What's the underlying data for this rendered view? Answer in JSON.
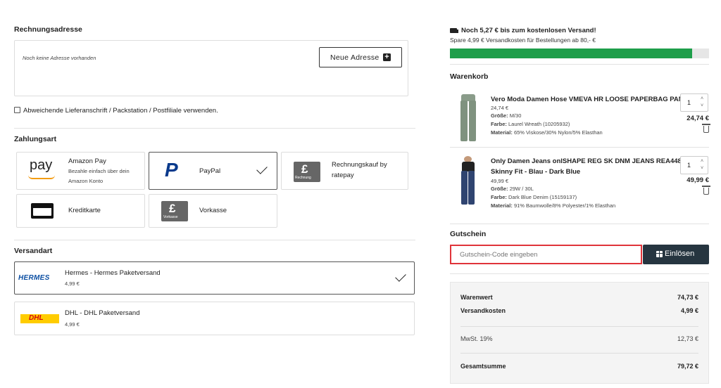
{
  "billing": {
    "title": "Rechnungsadresse",
    "empty_text": "Noch keine Adresse vorhanden",
    "new_address_label": "Neue Adresse",
    "alt_shipping_label": "Abweichende Lieferanschrift / Packstation / Postfiliale verwenden."
  },
  "payment": {
    "title": "Zahlungsart",
    "amazon": {
      "logo": "pay",
      "name": "Amazon Pay",
      "desc_1": "Bezahle einfach über dein",
      "desc_2": "Amazon Konto"
    },
    "paypal": {
      "logo": "P",
      "name": "PayPal"
    },
    "invoice": {
      "logo_caption": "Rechnung",
      "name_1": "Rechnungskauf by",
      "name_2": "ratepay"
    },
    "card": {
      "name": "Kreditkarte"
    },
    "prepay": {
      "logo_caption": "Vorkasse",
      "name": "Vorkasse"
    }
  },
  "shipping": {
    "title": "Versandart",
    "hermes": {
      "logo": "HERMES",
      "name": "Hermes - Hermes Paketversand",
      "price": "4,99 €"
    },
    "dhl": {
      "logo": "DHL",
      "name": "DHL - DHL Paketversand",
      "price": "4,99 €"
    }
  },
  "free_shipping": {
    "headline": "Noch 5,27 € bis zum kostenlosen Versand!",
    "subline": "Spare 4,99 € Versandkosten für Bestellungen ab 80,- €",
    "progress": 0.934,
    "bar_color": "#1e9e4a"
  },
  "cart": {
    "title": "Warenkorb",
    "items": [
      {
        "title_1": "Vero Moda Damen Hose VMEVA HR LOOSE PAPERBAG PANT",
        "title_2": "",
        "price": "24,74 €",
        "size_label": "Größe:",
        "size": "M/30",
        "color_label": "Farbe:",
        "color": "Laurel Wreath (10205932)",
        "material_label": "Material:",
        "material": "65% Viskose/30% Nylon/5% Elasthan",
        "qty": "1",
        "total": "24,74 €"
      },
      {
        "title_1": "Only Damen Jeans onlSHAPE REG SK DNM JEANS REA4488 -",
        "title_2": "Skinny Fit - Blau - Dark Blue",
        "price": "49,99 €",
        "size_label": "Größe:",
        "size": "29W / 30L",
        "color_label": "Farbe:",
        "color": "Dark Blue Denim (15159137)",
        "material_label": "Material:",
        "material": "91% Baumwolle/8% Polyester/1% Elasthan",
        "qty": "1",
        "total": "49,99 €"
      }
    ]
  },
  "voucher": {
    "title": "Gutschein",
    "placeholder": "Gutschein-Code eingeben",
    "redeem_label": "Einlösen",
    "highlight_color": "#e0343a"
  },
  "summary": {
    "goods_label": "Warenwert",
    "goods_value": "74,73 €",
    "shipping_label": "Versandkosten",
    "shipping_value": "4,99 €",
    "vat_label": "MwSt. 19%",
    "vat_value": "12,73 €",
    "total_label": "Gesamtsumme",
    "total_value": "79,72 €"
  }
}
